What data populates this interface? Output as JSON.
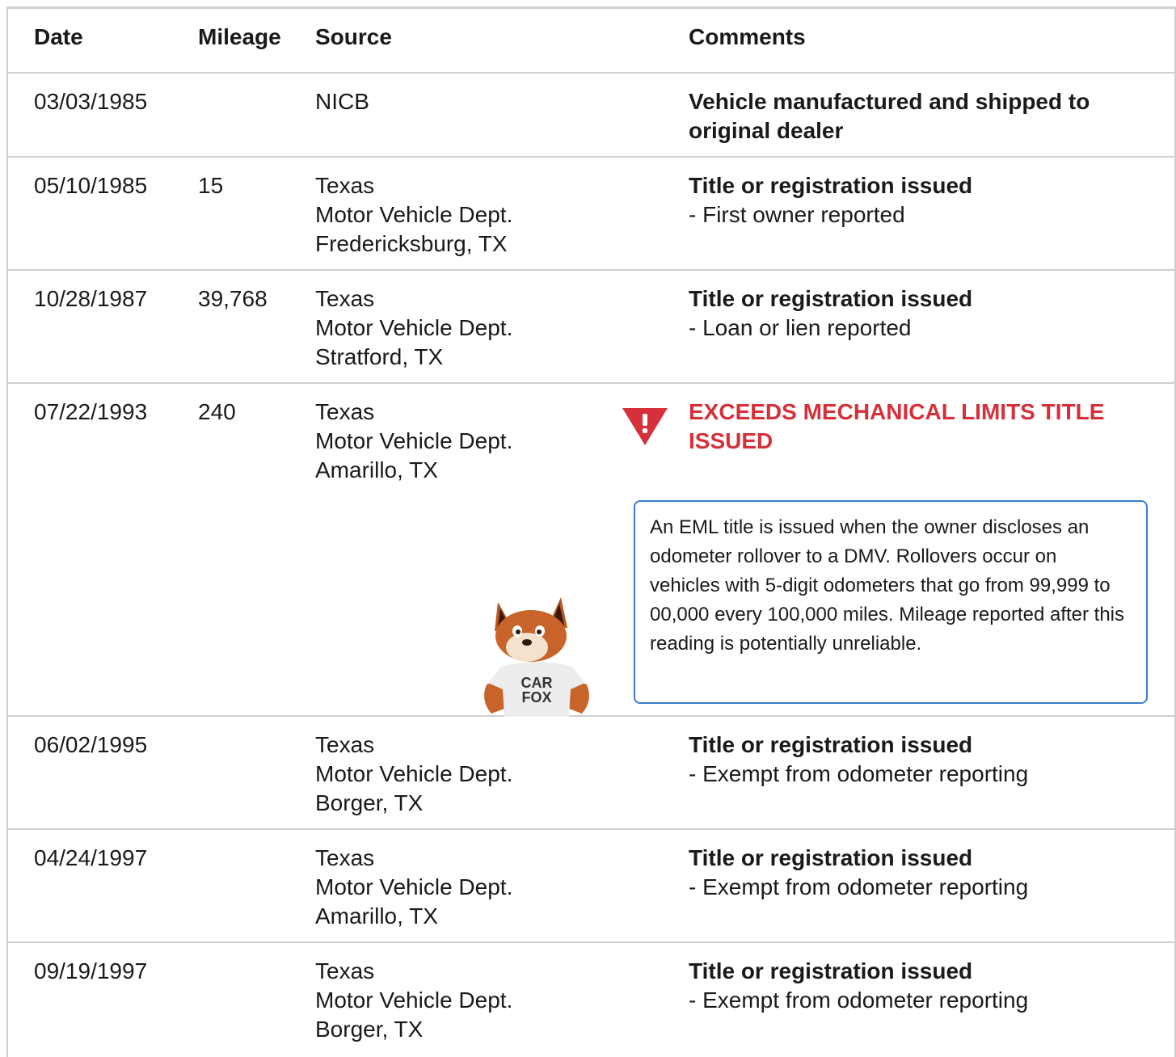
{
  "table": {
    "headers": {
      "date": "Date",
      "mileage": "Mileage",
      "source": "Source",
      "comments": "Comments"
    },
    "rows": [
      {
        "date": "03/03/1985",
        "mileage": "",
        "source": [
          "NICB"
        ],
        "title": "Vehicle manufactured and shipped to original dealer",
        "detail": ""
      },
      {
        "date": "05/10/1985",
        "mileage": "15",
        "source": [
          "Texas",
          "Motor Vehicle Dept.",
          "Fredericksburg, TX"
        ],
        "title": "Title or registration issued",
        "detail": "- First owner reported"
      },
      {
        "date": "10/28/1987",
        "mileage": "39,768",
        "source": [
          "Texas",
          "Motor Vehicle Dept.",
          "Stratford, TX"
        ],
        "title": "Title or registration issued",
        "detail": "- Loan or lien reported"
      },
      {
        "date": "07/22/1993",
        "mileage": "240",
        "source": [
          "Texas",
          "Motor Vehicle Dept.",
          "Amarillo, TX"
        ],
        "warning_title": "EXCEEDS MECHANICAL LIMITS TITLE ISSUED",
        "warning_note": "An EML title is issued when the owner discloses an odometer rollover to a DMV. Rollovers occur on vehicles with 5-digit odometers that go from 99,999 to 00,000 every 100,000 miles. Mileage reported after this reading is potentially unreliable.",
        "mascot_shirt": [
          "CAR",
          "FOX"
        ]
      },
      {
        "date": "06/02/1995",
        "mileage": "",
        "source": [
          "Texas",
          "Motor Vehicle Dept.",
          "Borger, TX"
        ],
        "title": "Title or registration issued",
        "detail": "- Exempt from odometer reporting"
      },
      {
        "date": "04/24/1997",
        "mileage": "",
        "source": [
          "Texas",
          "Motor Vehicle Dept.",
          "Amarillo, TX"
        ],
        "title": "Title or registration issued",
        "detail": "- Exempt from odometer reporting"
      },
      {
        "date": "09/19/1997",
        "mileage": "",
        "source": [
          "Texas",
          "Motor Vehicle Dept.",
          "Borger, TX"
        ],
        "title": "Title or registration issued",
        "detail": "- Exempt from odometer reporting"
      }
    ]
  },
  "colors": {
    "warning": "#d6303a",
    "note_border": "#3b7ec9",
    "divider": "#cfcfcf"
  },
  "icons": {
    "warning": "warning-triangle-icon",
    "mascot": "carfox-mascot"
  }
}
